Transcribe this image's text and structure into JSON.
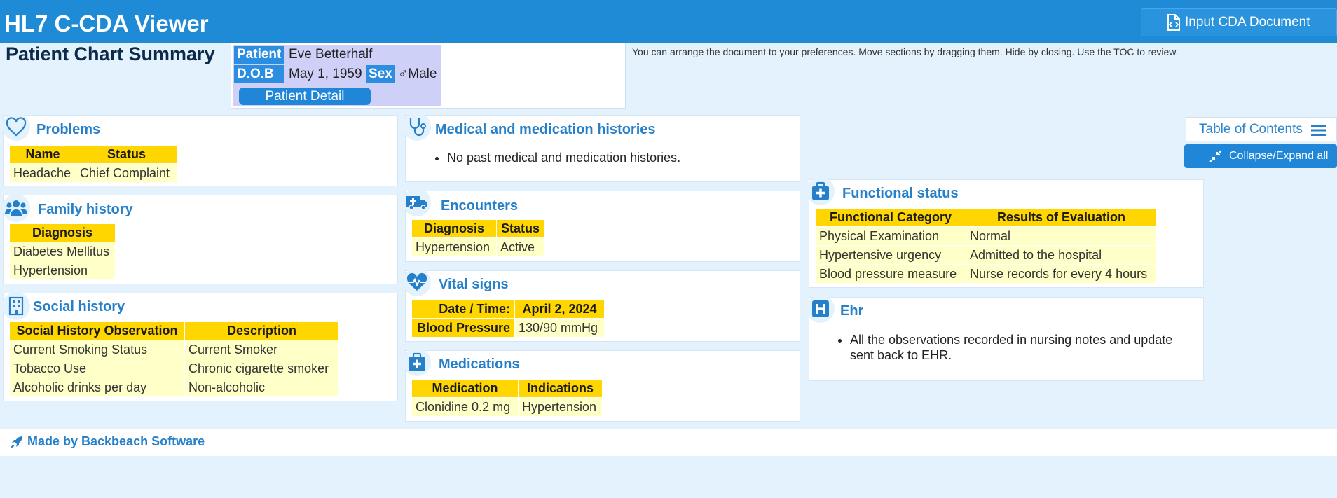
{
  "app": {
    "title": "HL7 C-CDA Viewer",
    "input_button": "Input CDA Document"
  },
  "page": {
    "title": "Patient Chart Summary",
    "hint": "You can arrange the document to your preferences. Move sections by dragging them. Hide by closing. Use the TOC to review."
  },
  "patient": {
    "patient_label": "Patient",
    "name": "Eve Betterhalf",
    "dob_label": "D.O.B",
    "dob": "May 1, 1959",
    "sex_label": "Sex",
    "sex": "♂Male",
    "detail_button": "Patient Detail"
  },
  "toc": {
    "label": "Table of Contents",
    "collapse_label": "Collapse/Expand all"
  },
  "problems": {
    "title": "Problems",
    "icon": "heart-icon",
    "headers": [
      "Name",
      "Status"
    ],
    "rows": [
      [
        "Headache",
        "Chief Complaint"
      ]
    ]
  },
  "family": {
    "title": "Family history",
    "icon": "people-icon",
    "headers": [
      "Diagnosis"
    ],
    "rows": [
      [
        "Diabetes Mellitus"
      ],
      [
        "Hypertension"
      ]
    ]
  },
  "social": {
    "title": "Social history",
    "icon": "building-icon",
    "headers": [
      "Social History Observation",
      "Description"
    ],
    "rows": [
      [
        "Current Smoking Status",
        "Current Smoker"
      ],
      [
        "Tobacco Use",
        "Chronic cigarette smoker"
      ],
      [
        "Alcoholic drinks per day",
        "Non-alcoholic"
      ]
    ]
  },
  "medhist": {
    "title": "Medical and medication histories",
    "icon": "stethoscope-icon",
    "items": [
      "No past medical and medication histories."
    ]
  },
  "encounters": {
    "title": "Encounters",
    "icon": "ambulance-icon",
    "headers": [
      "Diagnosis",
      "Status"
    ],
    "rows": [
      [
        "Hypertension",
        "Active"
      ]
    ]
  },
  "vitals": {
    "title": "Vital signs",
    "icon": "heartbeat-icon",
    "date_label": "Date / Time:",
    "date": "April 2, 2024",
    "rows": [
      [
        "Blood Pressure",
        "130/90 mmHg"
      ]
    ]
  },
  "medications": {
    "title": "Medications",
    "icon": "medkit-icon",
    "headers": [
      "Medication",
      "Indications"
    ],
    "rows": [
      [
        "Clonidine 0.2 mg",
        "Hypertension"
      ]
    ]
  },
  "functional": {
    "title": "Functional status",
    "icon": "medkit-icon",
    "headers": [
      "Functional Category",
      "Results of Evaluation"
    ],
    "rows": [
      [
        "Physical Examination",
        "Normal"
      ],
      [
        "Hypertensive urgency",
        "Admitted to the hospital"
      ],
      [
        "Blood pressure measure",
        "Nurse records for every 4 hours"
      ]
    ]
  },
  "ehr": {
    "title": "Ehr",
    "icon": "hospital-icon",
    "items": [
      "All the observations recorded in nursing notes and update sent back to EHR."
    ]
  },
  "footer": {
    "text": "Made by Backbeach Software"
  },
  "colors": {
    "header": "#1f8ad6",
    "accent": "#2680c9",
    "table_header": "#ffd600",
    "table_cell": "#ffffc8",
    "background": "#e3f2fc"
  }
}
